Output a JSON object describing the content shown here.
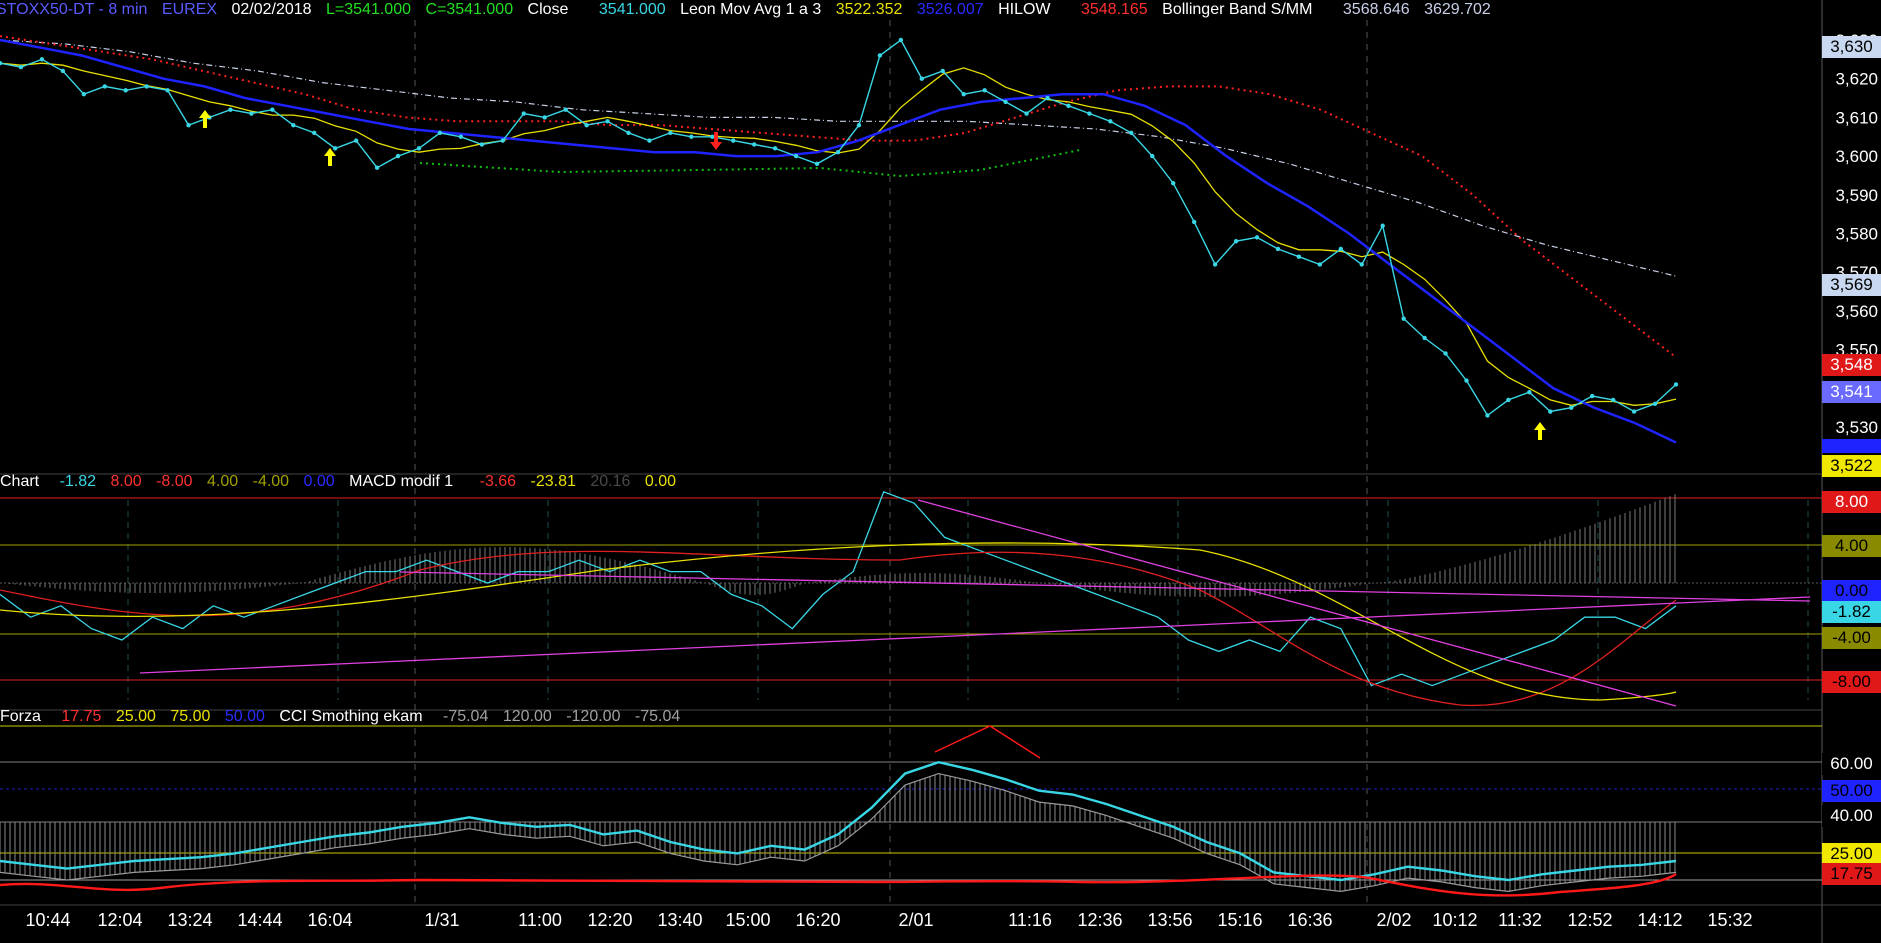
{
  "header_main": {
    "symbol": "STOXX50-DT - 8 min",
    "exchange": "EUREX",
    "date": "02/02/2018",
    "low": "L=3541.000",
    "close_eq": "C=3541.000",
    "close_label": "Close",
    "close_value": "3541.000",
    "leon_label": "Leon Mov Avg 1 a 3",
    "leon_value1": "3522.352",
    "leon_value2": "3526.007",
    "hilow_label": "HILOW",
    "hilow_value": "3548.165",
    "bb_label": "Bollinger Band S/MM",
    "bb_value1": "3568.646",
    "bb_value2": "3629.702"
  },
  "header_macd": {
    "chart_label": "Chart",
    "v1": "-1.82",
    "v2": "8.00",
    "v3": "-8.00",
    "v4": "4.00",
    "v5": "-4.00",
    "v6": "0.00",
    "macd_label": "MACD modif 1",
    "v7": "-3.66",
    "v8": "-23.81",
    "v9": "20.16",
    "v10": "0.00"
  },
  "header_cci": {
    "forza_label": "Forza",
    "v1": "17.75",
    "v2": "25.00",
    "v3": "75.00",
    "v4": "50.00",
    "cci_label": "CCI Smothing ekam",
    "v5": "-75.04",
    "v6": "120.00",
    "v7": "-120.00",
    "v8": "-75.04"
  },
  "price_tags": {
    "t3630": "3,630",
    "t3569": "3,569",
    "t3548": "3,548",
    "t3541": "3,541",
    "t3522": "3,522"
  },
  "macd_tags": {
    "t8": "8.00",
    "t4": "4.00",
    "t0": "0.00",
    "tm182": "-1.82",
    "tm4": "-4.00",
    "tm8": "-8.00"
  },
  "cci_tags": {
    "t60": "60.00",
    "t50": "50.00",
    "t40": "40.00",
    "t25": "25.00",
    "t1775": "17.75"
  },
  "colors": {
    "close": "#39d7e6",
    "leon": "#1e23ff",
    "leon_yellow": "#e8e000",
    "hilow_red": "#ff2020",
    "hilow_green": "#10c010",
    "bollinger": "#c8d0e8",
    "magenta": "#e040e0"
  },
  "chart_data": [
    {
      "type": "line",
      "panel": "price",
      "title": "STOXX50-DT - 8 min",
      "x_ticks": [
        "10:44",
        "12:04",
        "13:24",
        "14:44",
        "16:04",
        "1/31",
        "11:00",
        "12:20",
        "13:40",
        "15:00",
        "16:20",
        "2/01",
        "11:16",
        "12:36",
        "13:56",
        "15:16",
        "16:36",
        "2/02",
        "10:12",
        "11:32",
        "12:52",
        "14:12",
        "15:32"
      ],
      "y_ticks": [
        3530,
        3540,
        3550,
        3560,
        3570,
        3580,
        3590,
        3600,
        3610,
        3620,
        3630
      ],
      "ylim": [
        3520,
        3635
      ],
      "series": [
        {
          "name": "Close",
          "values": [
            3624,
            3623,
            3625,
            3622,
            3616,
            3618,
            3617,
            3618,
            3617,
            3608,
            3610,
            3612,
            3611,
            3612,
            3608,
            3606,
            3602,
            3604,
            3597,
            3600,
            3602,
            3606,
            3605,
            3603,
            3604,
            3611,
            3610,
            3612,
            3608,
            3609,
            3606,
            3604,
            3606,
            3605,
            3605,
            3604,
            3603,
            3602,
            3600,
            3598,
            3601,
            3608,
            3626,
            3630,
            3620,
            3622,
            3616,
            3617,
            3614,
            3611,
            3615,
            3613,
            3611,
            3609,
            3606,
            3600,
            3593,
            3583,
            3572,
            3578,
            3579,
            3576,
            3574,
            3572,
            3576,
            3572,
            3582,
            3558,
            3553,
            3549,
            3542,
            3533,
            3537,
            3539,
            3534,
            3535,
            3538,
            3537,
            3534,
            3536,
            3541
          ]
        },
        {
          "name": "Leon Mov Avg 1 a 3",
          "values": [
            3630,
            3628,
            3626,
            3623,
            3620,
            3618,
            3615,
            3613,
            3611,
            3609,
            3607,
            3606,
            3605,
            3604,
            3603,
            3602,
            3601,
            3601,
            3600,
            3600,
            3601,
            3604,
            3608,
            3612,
            3614,
            3615,
            3616,
            3616,
            3613,
            3608,
            3600,
            3593,
            3587,
            3580,
            3572,
            3564,
            3556,
            3548,
            3540,
            3535,
            3531,
            3526
          ]
        },
        {
          "name": "HILOW",
          "values": [
            3631,
            3629,
            3627,
            3625,
            3622,
            3619,
            3616,
            3612,
            3610,
            3609,
            3609,
            3609,
            3608,
            3608,
            3607,
            3606,
            3605,
            3604,
            3604,
            3606,
            3610,
            3614,
            3617,
            3618,
            3618,
            3616,
            3612,
            3606,
            3600,
            3590,
            3578,
            3568,
            3558,
            3548
          ]
        },
        {
          "name": "Bollinger Band S/MM",
          "values": [
            3630,
            3629,
            3627,
            3624,
            3622,
            3619,
            3617,
            3615,
            3614,
            3612,
            3611,
            3610,
            3610,
            3609,
            3609,
            3609,
            3608,
            3607,
            3605,
            3602,
            3598,
            3593,
            3588,
            3582,
            3577,
            3573,
            3569
          ]
        }
      ]
    },
    {
      "type": "line",
      "panel": "macd",
      "title": "MACD modif 1",
      "y_ticks": [
        8,
        4,
        0,
        -4,
        -8
      ],
      "ylim": [
        -10,
        10
      ],
      "series": [
        {
          "name": "Chart",
          "values": [
            -1,
            -3,
            -2,
            -4,
            -5,
            -3,
            -4,
            -2,
            -3,
            -2,
            -1,
            0,
            1,
            1,
            2,
            1,
            0,
            1,
            1,
            2,
            1,
            2,
            1,
            1,
            -1,
            -2,
            -4,
            -1,
            1,
            8,
            7,
            4,
            3,
            2,
            1,
            0,
            -1,
            -2,
            -3,
            -5,
            -6,
            -5,
            -6,
            -3,
            -4,
            -9,
            -8,
            -9,
            -8,
            -7,
            -6,
            -5,
            -3,
            -3,
            -4,
            -2
          ]
        }
      ]
    },
    {
      "type": "line",
      "panel": "cci",
      "title": "CCI Smothing ekam",
      "y_ticks": [
        60,
        50,
        40,
        25,
        17.75
      ],
      "ylim": [
        5,
        80
      ],
      "series": [
        {
          "name": "Forza",
          "values": [
            20,
            18,
            16,
            18,
            20,
            21,
            22,
            24,
            27,
            30,
            33,
            35,
            38,
            40,
            43,
            40,
            38,
            39,
            34,
            36,
            30,
            26,
            24,
            28,
            26,
            34,
            48,
            66,
            72,
            68,
            63,
            57,
            55,
            50,
            44,
            38,
            30,
            24,
            14,
            12,
            10,
            13,
            17,
            15,
            12,
            10,
            13,
            15,
            17,
            18,
            20
          ]
        }
      ]
    }
  ]
}
